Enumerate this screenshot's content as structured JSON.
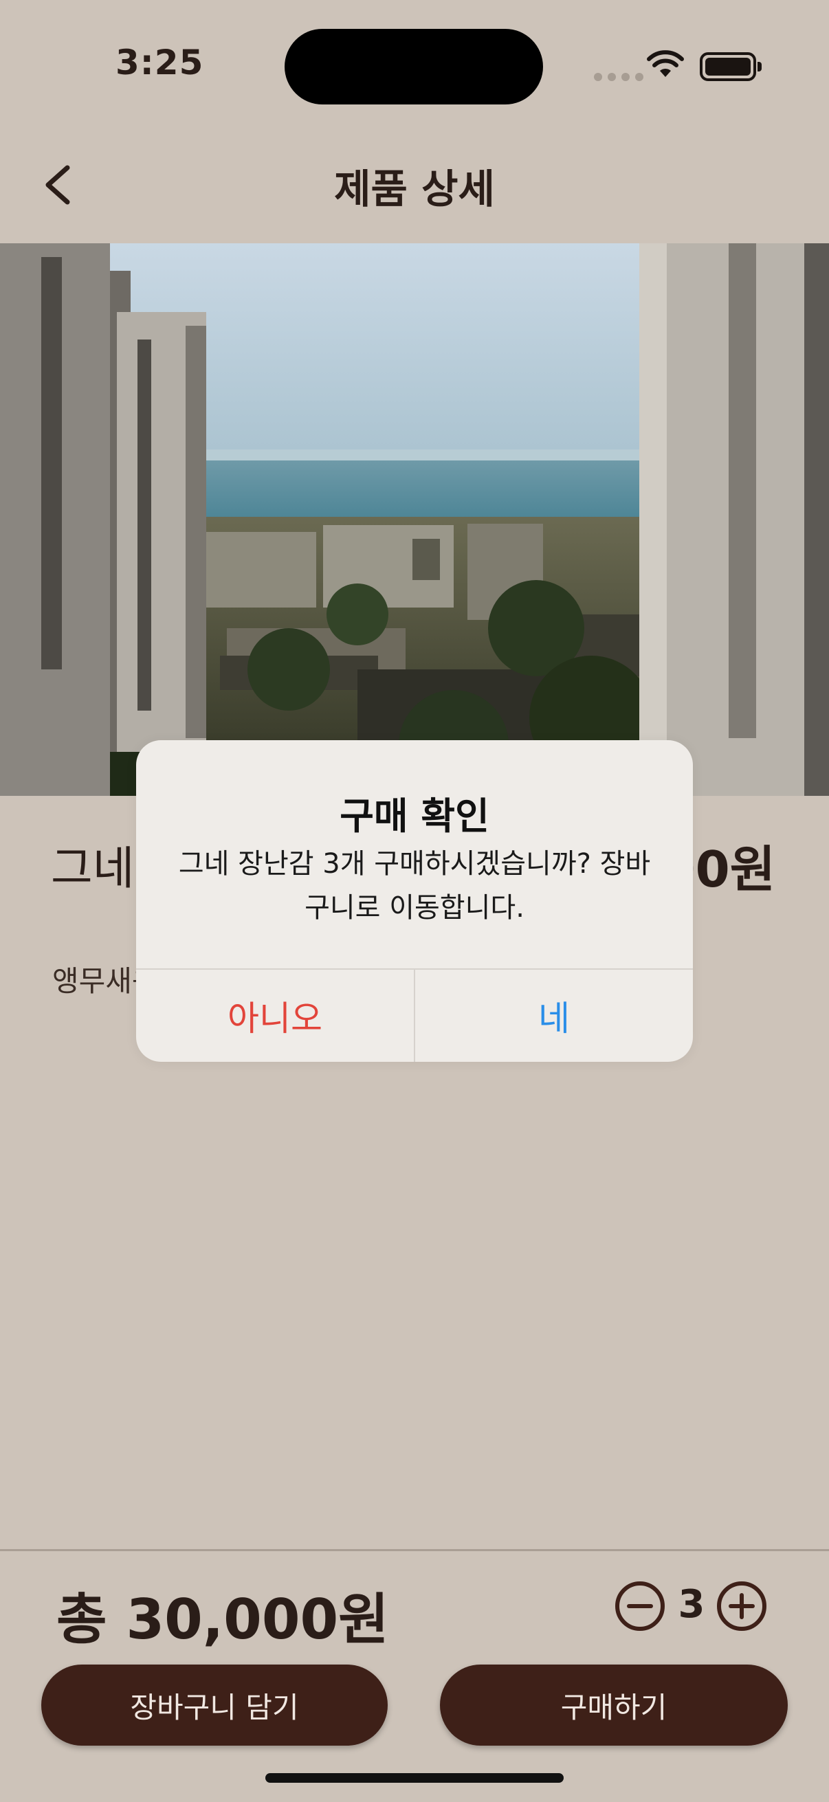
{
  "status_bar": {
    "time": "3:25"
  },
  "nav": {
    "title": "제품 상세"
  },
  "product": {
    "name": "그네 장난감",
    "price": "10,000원",
    "description": "앵무새용 그네 장난감"
  },
  "alert": {
    "title": "구매 확인",
    "message": "그네 장난감 3개 구매하시겠습니까? 장바구니로 이동합니다.",
    "no_label": "아니오",
    "yes_label": "네",
    "no_color": "#e2443a",
    "yes_color": "#2a8ee8"
  },
  "bottom": {
    "total_label": "총 30,000원",
    "quantity": "3",
    "cart_button": "장바구니 담기",
    "buy_button": "구매하기"
  },
  "colors": {
    "background": "#cdc3b9",
    "button": "#3e2018",
    "text": "#2a1d18"
  }
}
